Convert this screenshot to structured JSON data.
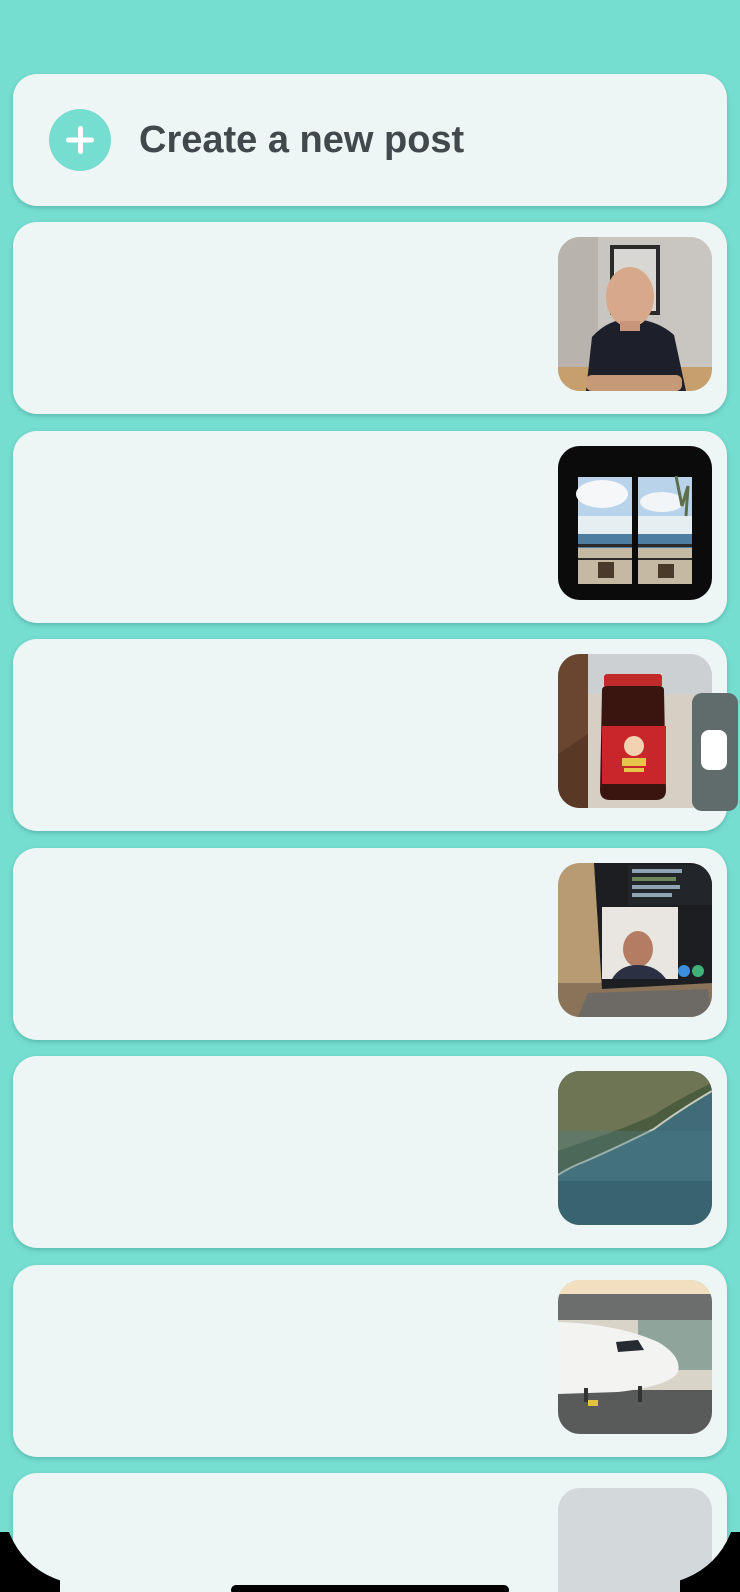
{
  "create_post": {
    "label": "Create a new post",
    "icon": "plus-icon"
  },
  "posts": [
    {
      "thumbnail": "photo-man-portrait"
    },
    {
      "thumbnail": "photo-window-sea-view"
    },
    {
      "thumbnail": "photo-chili-oil-jar"
    },
    {
      "thumbnail": "photo-laptop-video-call"
    },
    {
      "thumbnail": "photo-aerial-coastline"
    },
    {
      "thumbnail": "photo-airplane-at-gate"
    },
    {
      "thumbnail": "photo-placeholder"
    }
  ],
  "colors": {
    "background": "#76ddd1",
    "card": "#edf5f5",
    "accent": "#76ddd1",
    "text": "#42494c"
  }
}
